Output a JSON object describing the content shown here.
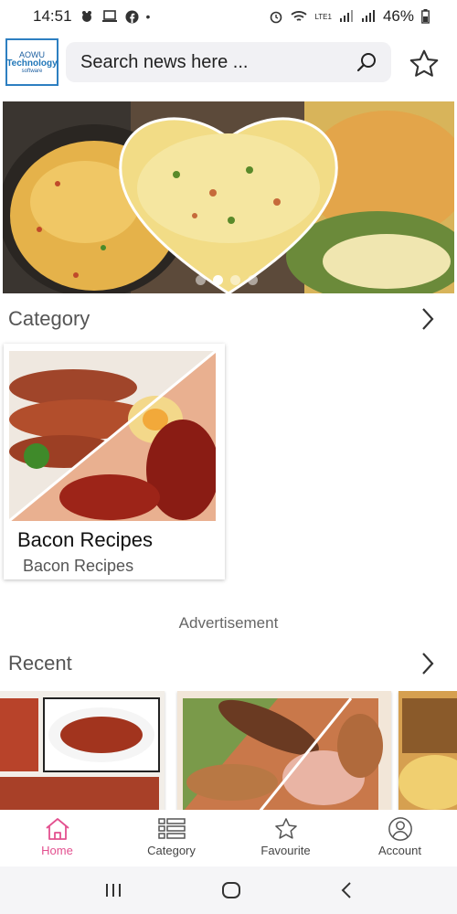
{
  "status_bar": {
    "time": "14:51",
    "battery": "46%",
    "network_label": "LTE1"
  },
  "header": {
    "logo_line1": "AOWU",
    "logo_line2": "Technology",
    "logo_line3": "software",
    "search_placeholder": "Search news here ...",
    "icons": {
      "search": "search-icon",
      "favorite": "star-icon"
    }
  },
  "banner": {
    "slides": 4,
    "active_slide": 1
  },
  "category_section": {
    "title": "Category",
    "items": [
      {
        "title": "Bacon Recipes",
        "subtitle": "Bacon Recipes"
      }
    ]
  },
  "advertisement_label": "Advertisement",
  "recent_section": {
    "title": "Recent"
  },
  "bottom_nav": [
    {
      "label": "Home",
      "icon": "home-icon",
      "active": true
    },
    {
      "label": "Category",
      "icon": "list-icon",
      "active": false
    },
    {
      "label": "Favourite",
      "icon": "star-icon",
      "active": false
    },
    {
      "label": "Account",
      "icon": "account-icon",
      "active": false
    }
  ],
  "colors": {
    "accent": "#e3508f",
    "logo_border": "#2d7fc1"
  }
}
